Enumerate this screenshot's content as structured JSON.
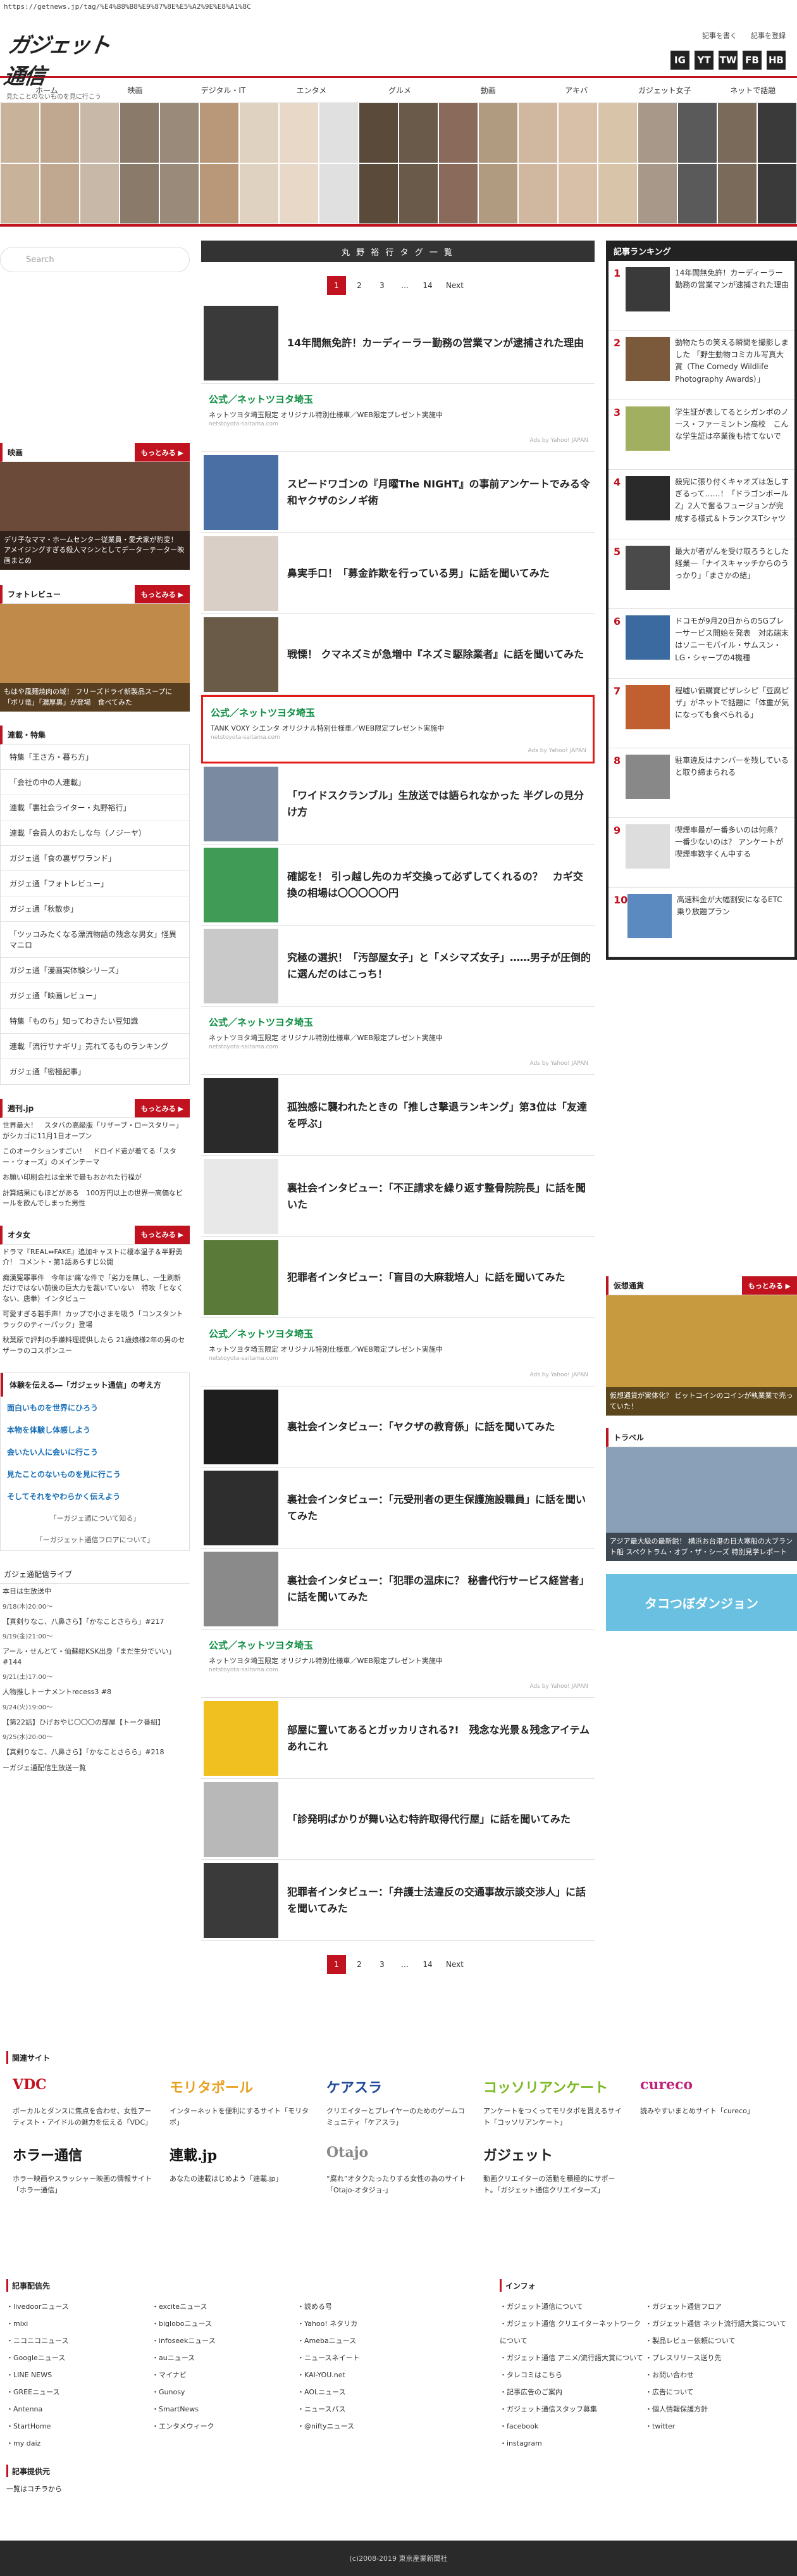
{
  "url": "https://getnews.jp/tag/%E4%B8%B8%E9%87%8E%E5%A2%9E%E8%A1%8C",
  "header": {
    "logo": "ガジェット通信",
    "tagline": "見たことのないものを見に行こう",
    "link_post": "記事を書く",
    "link_register": "記事を登録",
    "social": [
      "IG",
      "YT",
      "TW",
      "FB",
      "HB"
    ]
  },
  "nav": [
    "ホーム",
    "映画",
    "デジタル・IT",
    "エンタメ",
    "グルメ",
    "動画",
    "アキバ",
    "ガジェット女子",
    "ネットで話題"
  ],
  "search": {
    "placeholder": "Search"
  },
  "left": {
    "movie": {
      "title": "映画",
      "more": "もっとみる ▶",
      "caption": "デリ子なママ・ホームセンター従業員・愛犬家が豹変！ アメイジングすぎる殺人マシンとしてデーターテーター映画まとめ"
    },
    "photo": {
      "title": "フォトレビュー",
      "more": "もっとみる ▶",
      "caption": "もはや風麺焼肉の域！ フリーズドライ新製品スープに「ボリ竜」「濃厚黒」が登場　食べてみた"
    },
    "series_title": "連載・特集",
    "series": [
      "特集「王さ方・暮ち方」",
      "「会社の中の人連載」",
      "連載「裏社会ライター・丸野裕行」",
      "連載「会員人のおたしな与（ノジーヤ）",
      "ガジェ通「食の裏ザワランド」",
      "ガジェ通「フォトレビュー」",
      "ガジェ通「秋散歩」",
      "「ツッコみたくなる漂流物語の残念な男女」怪異マニロ",
      "ガジェ通「漫画実体験シリーズ」",
      "ガジェ通「映画レビュー」",
      "特集「ものち」知ってわきたい豆知識",
      "連載「流行サナギリ」売れてるものランキング",
      "ガジェ通「密極記事」"
    ],
    "dengeki": {
      "title": "週刊.jp",
      "more": "もっとみる ▶",
      "items": [
        "世界最大！　スタバの高級版「リザーブ・ロースタリー」がシカゴに11月1日オープン",
        "このオークションすごい！　ドロイド遣が着てる「スター・ウォーズ」のメインテーマ",
        "お願い印刷会社は全米で最もおかれた行程が",
        "計算結果にもほどがある　100万円以上の世界一高価なビールを飲んでしまった男性"
      ]
    },
    "otaku": {
      "title": "オタ女",
      "more": "もっとみる ▶",
      "items": [
        "ドラマ『REAL⇔FAKE』追加キャストに榎本温子＆半野勇介！ コメント・第1話あらすじ公開",
        "痴漢冤罪事件　今年は‘痛’な件で「劣力を無し、一生刷新だけではない前後の巨大力を裁いていない　特攻「ヒなくない、唐拳）インタビュー",
        "可愛すぎる若手声！カップで小さまを吸う「コンスタントラックのティーパック」登場",
        "秋葉原で評判の手嫌料理提供したら 21歳娘様2年の男のセザーラのコスポンユー"
      ]
    },
    "info_title": "体験を伝える―「ガジェット通信」の考え方",
    "info": [
      "面白いものを世界にひろう",
      "本物を体験し体感しよう",
      "会いたい人に会いに行こう",
      "見たことのないものを見に行こう",
      "そしてそれをやわらかく伝えよう",
      "「ーガジェ通について知る」",
      "「ーガジェット通信フロアについて」"
    ],
    "schedule_title": "ガジェ通配信ライブ",
    "schedule": [
      "本日は生放送中",
      "9/18(木)20:00〜",
      "【真剣りなこ、八鼻さら】「かなことさらら」#217",
      "9/19(金)21:00〜",
      "アール・せんとて・仙蘇総KSK出身「まだ生分でいい」#144",
      "9/21(土)17:00〜",
      "人物推しトーナメントrecess3 #8",
      "9/24(火)19:00〜",
      "【第22話】ひげおやじ〇〇〇の部屋【トーク番組】",
      "9/25(水)20:00〜",
      "【真剣りなこ、八鼻さら】「かなことさらら」#218",
      "ーガジェ通配信生放送一覧"
    ]
  },
  "center": {
    "title": "丸 野 裕 行 タ グ 一 覧",
    "pager": [
      "1",
      "2",
      "3",
      "…",
      "14",
      "Next"
    ],
    "items": [
      {
        "type": "art",
        "title": "14年間無免許！カーディーラー勤務の営業マンが逮捕された理由",
        "c": "#3a3a3a"
      },
      {
        "type": "ad",
        "title": "公式／ネットツヨタ埼玉",
        "body": "ネットツヨタ埼玉限定 オリジナル特別仕様車／WEB限定プレゼント実施中",
        "url": "netstoyota-saitama.com",
        "y": "Ads by Yahoo! JAPAN"
      },
      {
        "type": "art",
        "title": "スピードワゴンの『月曜The NIGHT』の事前アンケートでみる令和ヤクザのシノギ術",
        "c": "#4a6fa5"
      },
      {
        "type": "art",
        "title": "鼻実手口！「募金詐欺を行っている男」に話を聞いてみた",
        "c": "#d9cfc6"
      },
      {
        "type": "art",
        "title": "戦慄！ クマネズミが急増中『ネズミ駆除業者』に話を聞いてみた",
        "c": "#6a5a48"
      },
      {
        "type": "adred",
        "title": "公式／ネットツヨタ埼玉",
        "body": "TANK VOXY シエンタ オリジナル特別仕様車／WEB限定プレゼント実施中",
        "url": "netstoyota-saitama.com",
        "y": "Ads by Yahoo! JAPAN"
      },
      {
        "type": "art",
        "title": "「ワイドスクランブル」生放送では語られなかった 半グレの見分け方",
        "c": "#7a8aa0"
      },
      {
        "type": "art",
        "title": "確認を！ 引っ越し先のカギ交換って必ずしてくれるの？　カギ交換の相場は〇〇〇〇〇円",
        "c": "#3f9b55"
      },
      {
        "type": "art",
        "title": "究極の選択！「汚部屋女子」と「メシマズ女子」……男子が圧倒的に選んだのはこっち！",
        "c": "#c9c9c9"
      },
      {
        "type": "ad",
        "title": "公式／ネットツヨタ埼玉",
        "body": "ネットツヨタ埼玉限定 オリジナル特別仕様車／WEB限定プレゼント実施中",
        "url": "netstoyota-saitama.com",
        "y": "Ads by Yahoo! JAPAN"
      },
      {
        "type": "art",
        "title": "孤独感に襲われたときの「推しさ撃退ランキング」第3位は「友達を呼ぶ」",
        "c": "#2a2a2a"
      },
      {
        "type": "art",
        "title": "裏社会インタビュー：「不正請求を繰り返す整骨院院長」に話を聞いた",
        "c": "#e8e8e8"
      },
      {
        "type": "art",
        "title": "犯罪者インタビュー：「盲目の大麻栽培人」に話を聞いてみた",
        "c": "#5a7a3a"
      },
      {
        "type": "ad",
        "title": "公式／ネットツヨタ埼玉",
        "body": "ネットツヨタ埼玉限定 オリジナル特別仕様車／WEB限定プレゼント実施中",
        "url": "netstoyota-saitama.com",
        "y": "Ads by Yahoo! JAPAN"
      },
      {
        "type": "art",
        "title": "裏社会インタビュー：「ヤクザの教育係」に話を聞いてみた",
        "c": "#1e1e1e"
      },
      {
        "type": "art",
        "title": "裏社会インタビュー：「元受刑者の更生保護施設職員」に話を聞いてみた",
        "c": "#2e2e2e"
      },
      {
        "type": "art",
        "title": "裏社会インタビュー：「犯罪の温床に？ 秘書代行サービス経営者」に話を聞いてみた",
        "c": "#8a8a8a"
      },
      {
        "type": "ad",
        "title": "公式／ネットツヨタ埼玉",
        "body": "ネットツヨタ埼玉限定 オリジナル特別仕様車／WEB限定プレゼント実施中",
        "url": "netstoyota-saitama.com",
        "y": "Ads by Yahoo! JAPAN"
      },
      {
        "type": "art",
        "title": "部屋に置いてあるとガッカリされる?!　残念な光景＆残念アイテムあれこれ",
        "c": "#f0c020"
      },
      {
        "type": "art",
        "title": "「診発明ばかりが舞い込む特許取得代行屋」に話を聞いてみた",
        "c": "#b8b8b8"
      },
      {
        "type": "art",
        "title": "犯罪者インタビュー：「弁護士法違反の交通事故示談交渉人」に話を聞いてみた",
        "c": "#3a3a3a"
      }
    ]
  },
  "right": {
    "ranking_title": "記事ランキング",
    "ranking": [
      {
        "n": "1",
        "t": "14年間無免許！カーディーラー勤務の営業マンが逮捕された理由",
        "c": "#3a3a3a"
      },
      {
        "n": "2",
        "t": "動物たちの笑える瞬間を撮影しました 「野生動物コミカル写真大賞（The Comedy Wildlife Photography Awards）」",
        "c": "#7a5a3a"
      },
      {
        "n": "3",
        "t": "学生証が表してるとシガンボのノース・ファーミントン高校　こんな学生証は卒業後も捨てないで",
        "c": "#a0b060"
      },
      {
        "n": "4",
        "t": "殺完に張り付くキャオズは怎しすぎるって……！「ドラゴンボールZ」2人で奮るフュージョンが完成する様式＆トランクスTシャツ",
        "c": "#2a2a2a"
      },
      {
        "n": "5",
        "t": "最大が者がんを受け取ろうとした経業一「ナイスキャッチからのうっかり」「まさかの結」",
        "c": "#4a4a4a"
      },
      {
        "n": "6",
        "t": "ドコモが9月20日からの5Gプレーサービス開始を発表　対応端末はソニーモバイル・サムスン・LG・シャープの4機種",
        "c": "#3a6aa0"
      },
      {
        "n": "7",
        "t": "程嘘い価購寶ピザレシピ「豆腐ピザ」がネットで話題に「体重が気になっても食べられる」",
        "c": "#c06030"
      },
      {
        "n": "8",
        "t": "駐車違反はナンバーを残していると取り締まられる",
        "c": "#888888"
      },
      {
        "n": "9",
        "t": "喫煙率最がー番多いのは何県？ 一番少ないのは？ アンケートが喫煙率数字くん中する",
        "c": "#dddddd"
      },
      {
        "n": "10",
        "t": "高速料金が大幅割安になるETC乗り放題プラン",
        "c": "#5a8ac0"
      }
    ],
    "bitcoin": {
      "title": "仮想通貨",
      "more": "もっとみる ▶",
      "caption": "仮想通貨が実体化？ ビットコインのコインが執業業で売っていた！"
    },
    "travel": {
      "title": "トラベル",
      "caption": "アジア最大級の最新鋭！ 横浜お台港の日大寒船の大ブラント船 スペクトラム・オブ・ザ・シーズ 特別見学レポート"
    },
    "banner": "タコつぼダンジョン"
  },
  "footer": {
    "related_title": "関連サイト",
    "related": [
      {
        "lg": "VDC",
        "ds": "ボーカルとダンスに焦点を合わせ、女性アーティスト・アイドルの魅力を伝える「VDC」",
        "c": "#c1121f"
      },
      {
        "lg": "モリタポール",
        "ds": "インターネットを便利にするサイト「モリタポ」",
        "c": "#e8a020"
      },
      {
        "lg": "ケアスラ",
        "ds": "クリエイターとプレイヤーのためのゲームコミュニティ「ケアスラ」",
        "c": "#1e4a9a"
      },
      {
        "lg": "コッソリアンケート",
        "ds": "アンケートをつくってモリタポを貰えるサイト「コッソリアンケート」",
        "c": "#7ab820"
      },
      {
        "lg": "cureco",
        "ds": "読みやすいまとめサイト「cureco」",
        "c": "#c0207a"
      },
      {
        "lg": "ホラー通信",
        "ds": "ホラー映画やスラッシャー映画の情報サイト「ホラー通信」",
        "c": "#111111"
      },
      {
        "lg": "連載.jp",
        "ds": "あなたの連載はじめよう「連載.jp」",
        "c": "#111111"
      },
      {
        "lg": "Otajo",
        "ds": "“腐れ”オタクたったりする女性の為のサイト「Otajo-オタジョ-」",
        "c": "#888888"
      },
      {
        "lg": "ガジェット",
        "ds": "動画クリエイターの活動を積極的にサポート。「ガジェット通信クリエイターズ」",
        "c": "#222222"
      }
    ],
    "share_title": "記事配信先",
    "share_cols": [
      [
        "livedoorニュース",
        "mixi",
        "ニコニコニュース",
        "Googleニュース",
        "LINE NEWS",
        "GREEニュース",
        "Antenna",
        "StartHome",
        "my daiz"
      ],
      [
        "exciteニュース",
        "bigloboニュース",
        "infoseekニュース",
        "auニュース",
        "マイナビ",
        "Gunosy",
        "SmartNews",
        "エンタメウィーク"
      ],
      [
        "読める号",
        "Yahoo! ネタリカ",
        "Amebaニュース",
        "ニュースネイート",
        "KAI-YOU.net",
        "AOLニュース",
        "ニュースパス",
        "@niftyニュース"
      ]
    ],
    "info_title": "インフォ",
    "info_cols": [
      [
        "ガジェット通信について",
        "ガジェット通信 クリエイターネットワークについて",
        "ガジェット通信 アニメ/流行語大賞について",
        "タレコミはこちら",
        "記事広告のご案内",
        "ガジェット通信スタッフ募集",
        "facebook",
        "instagram"
      ],
      [
        "ガジェット通信フロア",
        "ガジェット通信 ネット流行語大賞について",
        "製品レビュー依頼について",
        "プレスリリース送り先",
        "お問い合わせ",
        "広告について",
        "個人情報保護方針",
        "twitter"
      ]
    ],
    "provider_title": "記事提供元",
    "provider": "一覧はコチラから",
    "copyright": "(c)2008-2019 東京産業新聞社"
  }
}
